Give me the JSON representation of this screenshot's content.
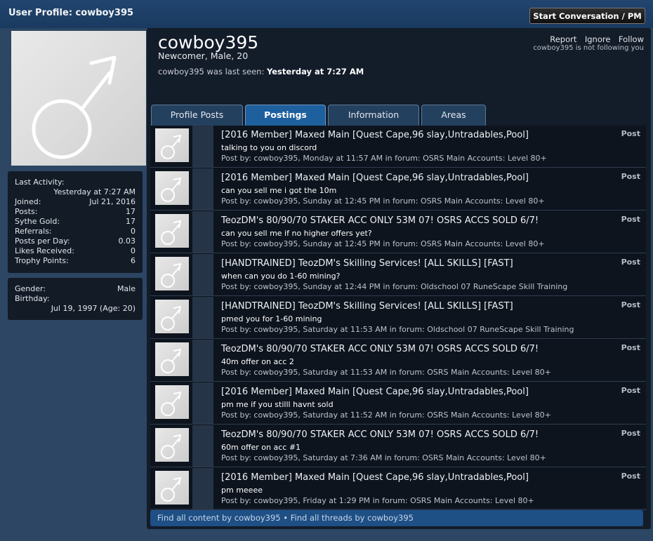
{
  "header": {
    "title": "User Profile: cowboy395",
    "pm_button": "Start Conversation / PM"
  },
  "profile": {
    "username": "cowboy395",
    "subtitle": "Newcomer, Male, 20",
    "last_seen_prefix": "cowboy395 was last seen:",
    "last_seen_value": "Yesterday at 7:27 AM",
    "actions": {
      "report": "Report",
      "ignore": "Ignore",
      "follow": "Follow",
      "follow_status": "cowboy395 is not following you"
    }
  },
  "stats": {
    "last_activity_label": "Last Activity:",
    "last_activity_value": "Yesterday at 7:27 AM",
    "rows": [
      {
        "label": "Joined:",
        "value": "Jul 21, 2016"
      },
      {
        "label": "Posts:",
        "value": "17"
      },
      {
        "label": "Sythe Gold:",
        "value": "17"
      },
      {
        "label": "Referrals:",
        "value": "0"
      },
      {
        "label": "Posts per Day:",
        "value": "0.03"
      },
      {
        "label": "Likes Received:",
        "value": "0"
      },
      {
        "label": "Trophy Points:",
        "value": "6"
      }
    ]
  },
  "info": {
    "gender_label": "Gender:",
    "gender_value": "Male",
    "birthday_label": "Birthday:",
    "birthday_value": "Jul 19, 1997 (Age: 20)"
  },
  "tabs": [
    {
      "label": "Profile Posts",
      "active": false
    },
    {
      "label": "Postings",
      "active": true
    },
    {
      "label": "Information",
      "active": false
    },
    {
      "label": "Areas",
      "active": false
    }
  ],
  "posts": [
    {
      "title": "[2016 Member] Maxed Main [Quest Cape,96 slay,Untradables,Pool]",
      "snippet": "talking to you on discord",
      "meta": "Post by: cowboy395, Monday at 11:57 AM in forum: OSRS Main Accounts: Level 80+",
      "type": "Post"
    },
    {
      "title": "[2016 Member] Maxed Main [Quest Cape,96 slay,Untradables,Pool]",
      "snippet": "can you sell me i got the 10m",
      "meta": "Post by: cowboy395, Sunday at 12:45 PM in forum: OSRS Main Accounts: Level 80+",
      "type": "Post"
    },
    {
      "title": "TeozDM's 80/90/70 STAKER ACC ONLY 53M 07! OSRS ACCS SOLD 6/7!",
      "snippet": "can you sell me if no higher offers yet?",
      "meta": "Post by: cowboy395, Sunday at 12:45 PM in forum: OSRS Main Accounts: Level 80+",
      "type": "Post"
    },
    {
      "title": "[HANDTRAINED] TeozDM's Skilling Services! [ALL SKILLS] [FAST]",
      "snippet": "when can you do 1-60 mining?",
      "meta": "Post by: cowboy395, Sunday at 12:44 PM in forum: Oldschool 07 RuneScape Skill Training",
      "type": "Post"
    },
    {
      "title": "[HANDTRAINED] TeozDM's Skilling Services! [ALL SKILLS] [FAST]",
      "snippet": "pmed you for 1-60 mining",
      "meta": "Post by: cowboy395, Saturday at 11:53 AM in forum: Oldschool 07 RuneScape Skill Training",
      "type": "Post"
    },
    {
      "title": "TeozDM's 80/90/70 STAKER ACC ONLY 53M 07! OSRS ACCS SOLD 6/7!",
      "snippet": "40m offer on acc 2",
      "meta": "Post by: cowboy395, Saturday at 11:53 AM in forum: OSRS Main Accounts: Level 80+",
      "type": "Post"
    },
    {
      "title": "[2016 Member] Maxed Main [Quest Cape,96 slay,Untradables,Pool]",
      "snippet": "pm me if you stilll havnt sold",
      "meta": "Post by: cowboy395, Saturday at 11:52 AM in forum: OSRS Main Accounts: Level 80+",
      "type": "Post"
    },
    {
      "title": "TeozDM's 80/90/70 STAKER ACC ONLY 53M 07! OSRS ACCS SOLD 6/7!",
      "snippet": "60m offer on acc #1",
      "meta": "Post by: cowboy395, Saturday at 7:36 AM in forum: OSRS Main Accounts: Level 80+",
      "type": "Post"
    },
    {
      "title": "[2016 Member] Maxed Main [Quest Cape,96 slay,Untradables,Pool]",
      "snippet": "pm meeee",
      "meta": "Post by: cowboy395, Friday at 1:29 PM in forum: OSRS Main Accounts: Level 80+",
      "type": "Post"
    }
  ],
  "footer": {
    "find_content": "Find all content by cowboy395",
    "separator": "•",
    "find_threads": "Find all threads by cowboy395"
  },
  "icons": {
    "avatar": "male-symbol-icon"
  }
}
